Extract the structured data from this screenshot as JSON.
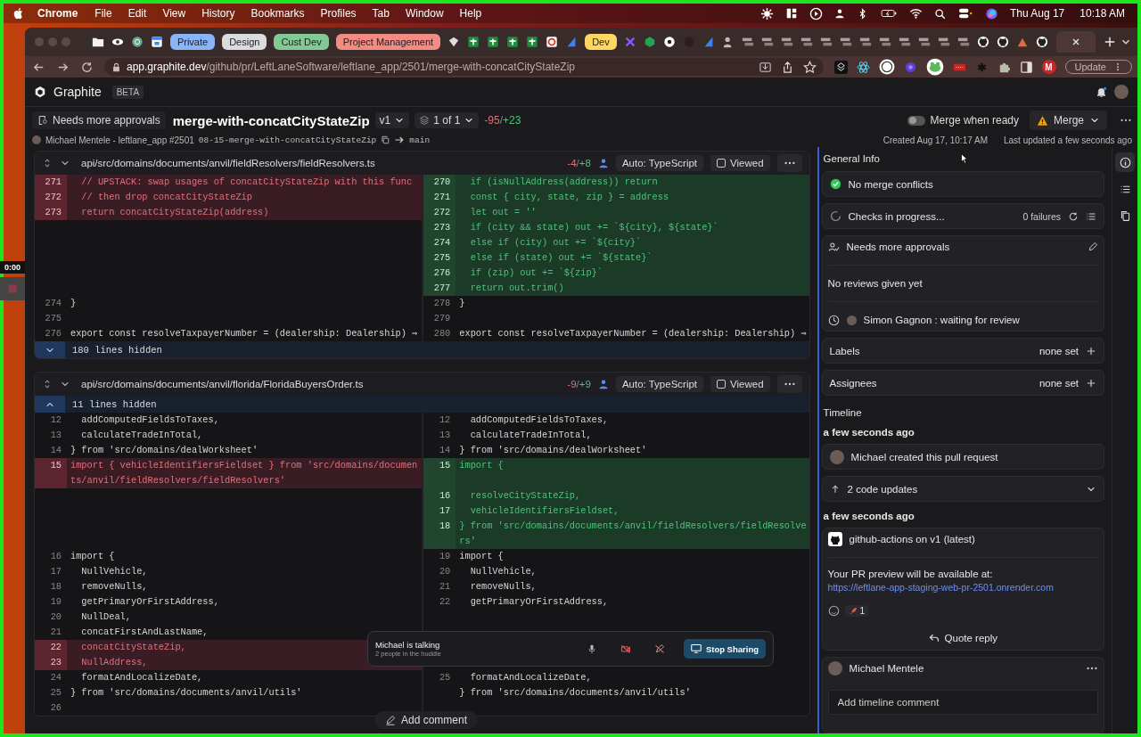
{
  "menubar": {
    "app": "Chrome",
    "menus": [
      "File",
      "Edit",
      "View",
      "History",
      "Bookmarks",
      "Profiles",
      "Tab",
      "Window",
      "Help"
    ],
    "date": "Thu Aug 17",
    "time": "10:18 AM"
  },
  "recorder": {
    "time": "0:00"
  },
  "browser": {
    "tabstrip": [
      {
        "kind": "tab",
        "selected": false
      },
      {
        "kind": "tab",
        "selected": false
      },
      {
        "kind": "tab",
        "selected": false
      },
      {
        "kind": "tab",
        "selected": false
      },
      {
        "kind": "group",
        "label": "Private",
        "color": "#8ab4f8"
      },
      {
        "kind": "group",
        "label": "Design",
        "color": "#dadce0"
      },
      {
        "kind": "group",
        "label": "Cust Dev",
        "color": "#81c995"
      },
      {
        "kind": "group",
        "label": "Project Management",
        "color": "#f28b82"
      },
      {
        "kind": "tab",
        "selected": false
      },
      {
        "kind": "tab",
        "selected": false
      },
      {
        "kind": "tab",
        "selected": false
      },
      {
        "kind": "tab",
        "selected": false
      },
      {
        "kind": "tab",
        "selected": false
      },
      {
        "kind": "tab",
        "selected": false
      },
      {
        "kind": "tab",
        "selected": false
      },
      {
        "kind": "group",
        "label": "Dev",
        "color": "#fdd663"
      },
      {
        "kind": "tab",
        "selected": false
      },
      {
        "kind": "tab",
        "selected": false
      },
      {
        "kind": "tab",
        "selected": false
      },
      {
        "kind": "tab",
        "selected": false
      },
      {
        "kind": "tab",
        "selected": false
      },
      {
        "kind": "tab",
        "selected": false
      },
      {
        "kind": "tab",
        "selected": false
      },
      {
        "kind": "tab",
        "selected": false
      },
      {
        "kind": "tab",
        "selected": false
      },
      {
        "kind": "tab",
        "selected": false
      },
      {
        "kind": "tab",
        "selected": false
      },
      {
        "kind": "tab",
        "selected": false
      },
      {
        "kind": "tab",
        "selected": false
      },
      {
        "kind": "tab",
        "selected": false
      },
      {
        "kind": "tab",
        "selected": false
      },
      {
        "kind": "tab",
        "selected": false
      },
      {
        "kind": "tab",
        "selected": false
      },
      {
        "kind": "tab",
        "selected": false
      },
      {
        "kind": "tab",
        "selected": false
      },
      {
        "kind": "tab",
        "selected": false
      },
      {
        "kind": "tab",
        "selected": false
      },
      {
        "kind": "tab",
        "selected": false
      },
      {
        "kind": "tab",
        "selected": true
      }
    ],
    "address": {
      "domain": "app.graphite.dev",
      "path": "/github/pr/LeftLaneSoftware/leftlane_app/2501/merge-with-concatCityStateZip"
    },
    "profile": "M",
    "update_button": "Update"
  },
  "app": {
    "brand": "Graphite",
    "badge": "BETA"
  },
  "pr": {
    "status": "Needs more approvals",
    "title": "merge-with-concatCityStateZip",
    "version": "v1",
    "stack": "1 of 1",
    "deletions": "-95",
    "separator": "/",
    "additions": "+23",
    "merge_when_ready": {
      "label": "Merge when ready",
      "on": false
    },
    "merge_button": "Merge",
    "author_line": "Michael Mentele - leftlane_app #2501",
    "branch": "08-15-merge-with-concatCityStateZip",
    "base": "main",
    "created": "Created Aug 17, 10:17 AM",
    "updated": "Last updated a few seconds ago"
  },
  "files": [
    {
      "path": "api/src/domains/documents/anvil/fieldResolvers/fieldResolvers.ts",
      "deletions": "-4",
      "separator": "/",
      "additions": "+8",
      "language": "Auto: TypeScript",
      "viewed_label": "Viewed",
      "viewed": false,
      "rows": [
        {
          "kind": "line",
          "left": {
            "num": "271",
            "kind": "del",
            "code": "  // UPSTACK: swap usages of concatCityStateZip with this func"
          },
          "right": {
            "num": "270",
            "kind": "add",
            "code": "  if (isNullAddress(address)) return"
          }
        },
        {
          "kind": "line",
          "left": {
            "num": "272",
            "kind": "del",
            "code": "  // then drop concatCityStateZip"
          },
          "right": {
            "num": "271",
            "kind": "add",
            "code": "  const { city, state, zip } = address"
          }
        },
        {
          "kind": "line",
          "left": {
            "num": "273",
            "kind": "del",
            "code": "  return concatCityStateZip(address)"
          },
          "right": {
            "num": "272",
            "kind": "add",
            "code": "  let out = ''"
          }
        },
        {
          "kind": "line",
          "right": {
            "num": "273",
            "kind": "add",
            "code": "  if (city && state) out += `${city}, ${state}`"
          }
        },
        {
          "kind": "line",
          "right": {
            "num": "274",
            "kind": "add",
            "code": "  else if (city) out += `${city}`"
          }
        },
        {
          "kind": "line",
          "right": {
            "num": "275",
            "kind": "add",
            "code": "  else if (state) out += `${state}`"
          }
        },
        {
          "kind": "line",
          "right": {
            "num": "276",
            "kind": "add",
            "code": "  if (zip) out += `${zip}`"
          }
        },
        {
          "kind": "line",
          "right": {
            "num": "277",
            "kind": "add",
            "code": "  return out.trim()"
          }
        },
        {
          "kind": "line",
          "left": {
            "num": "274",
            "kind": "ctx",
            "code": "}"
          },
          "right": {
            "num": "278",
            "kind": "ctx",
            "code": "}"
          }
        },
        {
          "kind": "line",
          "left": {
            "num": "275",
            "kind": "ctx"
          },
          "right": {
            "num": "279",
            "kind": "ctx"
          }
        },
        {
          "kind": "line",
          "left": {
            "num": "276",
            "kind": "ctx",
            "code": "export const resolveTaxpayerNumber = (dealership: Dealership) ⇒"
          },
          "right": {
            "num": "280",
            "kind": "ctx",
            "code": "export const resolveTaxpayerNumber = (dealership: Dealership) ⇒"
          }
        },
        {
          "kind": "expand_down",
          "text": "180 lines hidden"
        }
      ]
    },
    {
      "path": "api/src/domains/documents/anvil/florida/FloridaBuyersOrder.ts",
      "deletions": "-9",
      "separator": "/",
      "additions": "+9",
      "language": "Auto: TypeScript",
      "viewed_label": "Viewed",
      "viewed": false,
      "rows": [
        {
          "kind": "expand_up",
          "text": "11 lines hidden"
        },
        {
          "kind": "line",
          "left": {
            "num": "12",
            "kind": "ctx",
            "code": "  addComputedFieldsToTaxes,"
          },
          "right": {
            "num": "12",
            "kind": "ctx",
            "code": "  addComputedFieldsToTaxes,"
          }
        },
        {
          "kind": "line",
          "left": {
            "num": "13",
            "kind": "ctx",
            "code": "  calculateTradeInTotal,"
          },
          "right": {
            "num": "13",
            "kind": "ctx",
            "code": "  calculateTradeInTotal,"
          }
        },
        {
          "kind": "line",
          "left": {
            "num": "14",
            "kind": "ctx",
            "code": "} from 'src/domains/dealWorksheet'"
          },
          "right": {
            "num": "14",
            "kind": "ctx",
            "code": "} from 'src/domains/dealWorksheet'"
          }
        },
        {
          "kind": "line",
          "left": {
            "num": "15",
            "kind": "del",
            "code": "import { vehicleIdentifiersFieldset } from 'src/domains/documents/anvil/fieldResolvers/fieldResolvers'"
          },
          "right": {
            "num": "15",
            "kind": "add",
            "code": "import {"
          }
        },
        {
          "kind": "line",
          "right": {
            "num": "16",
            "kind": "add",
            "code": "  resolveCityStateZip,"
          }
        },
        {
          "kind": "line",
          "right": {
            "num": "17",
            "kind": "add",
            "code": "  vehicleIdentifiersFieldset,"
          }
        },
        {
          "kind": "line",
          "right": {
            "num": "18",
            "kind": "add",
            "code": "} from 'src/domains/documents/anvil/fieldResolvers/fieldResolvers'"
          }
        },
        {
          "kind": "line",
          "left": {
            "num": "16",
            "kind": "ctx",
            "code": "import {"
          },
          "right": {
            "num": "19",
            "kind": "ctx",
            "code": "import {"
          }
        },
        {
          "kind": "line",
          "left": {
            "num": "17",
            "kind": "ctx",
            "code": "  NullVehicle,"
          },
          "right": {
            "num": "20",
            "kind": "ctx",
            "code": "  NullVehicle,"
          }
        },
        {
          "kind": "line",
          "left": {
            "num": "18",
            "kind": "ctx",
            "code": "  removeNulls,"
          },
          "right": {
            "num": "21",
            "kind": "ctx",
            "code": "  removeNulls,"
          }
        },
        {
          "kind": "line",
          "left": {
            "num": "19",
            "kind": "ctx",
            "code": "  getPrimaryOrFirstAddress,"
          },
          "right": {
            "num": "22",
            "kind": "ctx",
            "code": "  getPrimaryOrFirstAddress,"
          }
        },
        {
          "kind": "line",
          "left": {
            "num": "20",
            "kind": "ctx",
            "code": "  NullDeal,"
          }
        },
        {
          "kind": "line",
          "left": {
            "num": "21",
            "kind": "ctx",
            "code": "  concatFirstAndLastName,"
          }
        },
        {
          "kind": "line",
          "left": {
            "num": "22",
            "kind": "del",
            "code": "  concatCityStateZip,"
          }
        },
        {
          "kind": "line",
          "left": {
            "num": "23",
            "kind": "del",
            "code": "  NullAddress,"
          }
        },
        {
          "kind": "line",
          "left": {
            "num": "24",
            "kind": "ctx",
            "code": "  formatAndLocalizeDate,"
          },
          "right": {
            "num": "25",
            "kind": "ctx",
            "code": "  formatAndLocalizeDate,"
          }
        },
        {
          "kind": "line",
          "left": {
            "num": "25",
            "kind": "ctx",
            "code": "} from 'src/domains/documents/anvil/utils'"
          },
          "right": {
            "kind": "ctx",
            "code": "} from 'src/domains/documents/anvil/utils'"
          }
        },
        {
          "kind": "line",
          "left": {
            "num": "26",
            "kind": "ctx"
          }
        }
      ]
    }
  ],
  "huddle": {
    "title": "Michael is talking",
    "subtitle": "2 people in the huddle",
    "action": "Stop Sharing"
  },
  "add_comment": "Add comment",
  "sidebar": {
    "heading": "General Info",
    "cards": [
      {
        "kind": "merge",
        "text": "No merge conflicts"
      },
      {
        "kind": "checks",
        "text": "Checks in progress...",
        "failures": "0 failures"
      },
      {
        "kind": "reviews",
        "text": "Needs more approvals",
        "note": "No reviews given yet",
        "reviewer": "Simon Gagnon : waiting for review"
      },
      {
        "kind": "field",
        "title": "Labels",
        "value": "none set"
      },
      {
        "kind": "field",
        "title": "Assignees",
        "value": "none set"
      }
    ],
    "timeline_heading": "Timeline",
    "timeline": [
      {
        "kind": "time",
        "text": "a few seconds ago"
      },
      {
        "kind": "event",
        "text": "Michael created this pull request"
      },
      {
        "kind": "updates",
        "text": "2 code updates",
        "expanded": false
      },
      {
        "kind": "time",
        "text": "a few seconds ago"
      },
      {
        "kind": "comment",
        "author": "github-actions on v1 (latest)",
        "body": "Your PR preview will be available at: ",
        "link": "https://leftlane-app-staging-web-pr-2501.onrender.com",
        "reaction_count": "1",
        "action": "Quote reply"
      }
    ],
    "composer": {
      "author": "Michael Mentele",
      "placeholder": "Add timeline comment"
    }
  },
  "rail": [
    {
      "selected": true
    },
    {
      "selected": false
    },
    {
      "selected": false
    }
  ]
}
